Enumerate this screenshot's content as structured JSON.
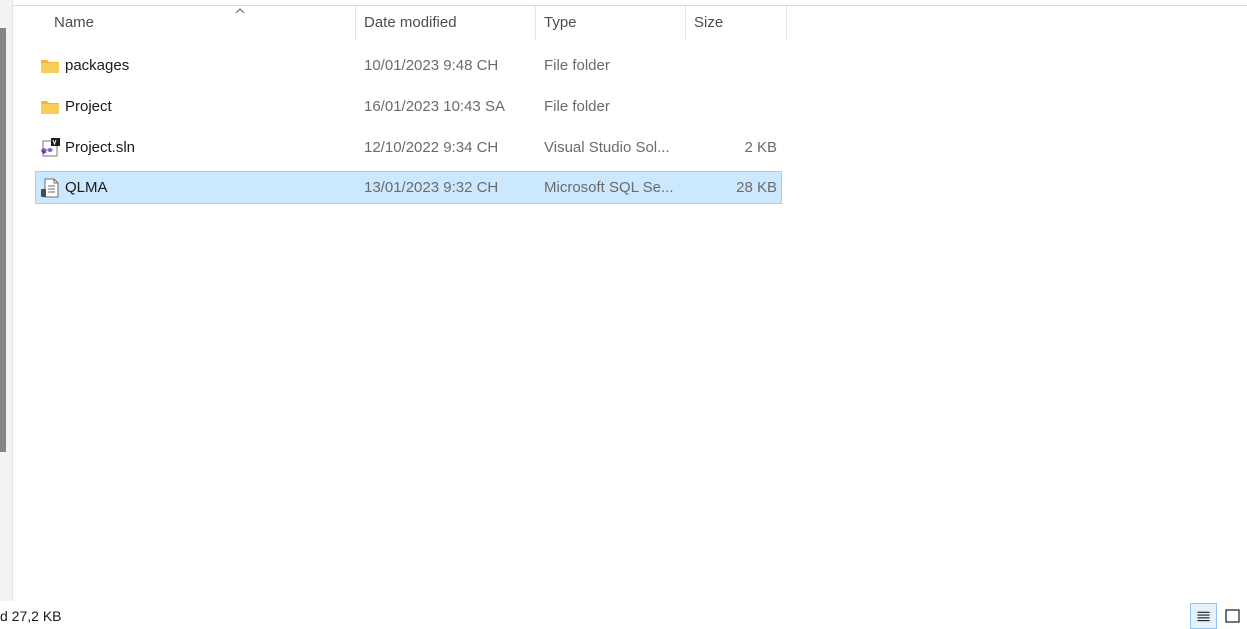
{
  "columns": {
    "name": "Name",
    "date": "Date modified",
    "type": "Type",
    "size": "Size"
  },
  "files": [
    {
      "name": "packages",
      "date": "10/01/2023 9:48 CH",
      "type": "File folder",
      "size": "",
      "icon": "folder-icon"
    },
    {
      "name": "Project",
      "date": "16/01/2023 10:43 SA",
      "type": "File folder",
      "size": "",
      "icon": "folder-icon"
    },
    {
      "name": "Project.sln",
      "date": "12/10/2022 9:34 CH",
      "type": "Visual Studio Sol...",
      "size": "2 KB",
      "icon": "visual-studio-solution-icon"
    },
    {
      "name": "QLMA",
      "date": "13/01/2023 9:32 CH",
      "type": "Microsoft SQL Se...",
      "size": "28 KB",
      "icon": "sql-script-icon",
      "selected": true
    }
  ],
  "status": {
    "selection_text": "d  27,2 KB"
  },
  "colors": {
    "selection_bg": "#cce8ff",
    "selection_border": "#99d1ff",
    "folder": "#f8c94a"
  }
}
